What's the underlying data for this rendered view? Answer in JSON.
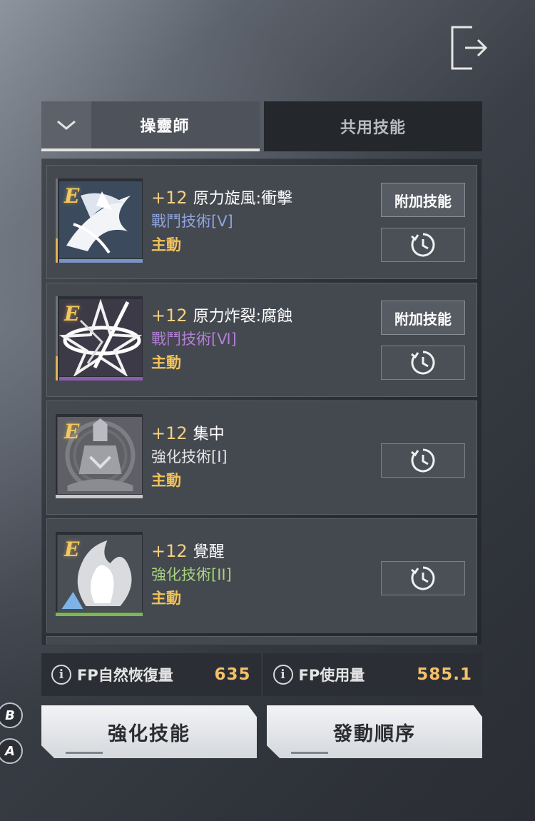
{
  "header": {
    "exit_icon": "exit-arrow-icon"
  },
  "tabs": {
    "toggle_icon": "chevron-down-icon",
    "active_label": "操靈師",
    "inactive_label": "共用技能"
  },
  "skills": [
    {
      "grade": "E",
      "level": "+12",
      "name": "原力旋風:衝擊",
      "category": "戰鬥技術[Ⅴ]",
      "category_color": "#8fa3de",
      "type": "主動",
      "extra_button": "附加技能",
      "cooldown_icon": "cooldown-clock-icon",
      "strip_color": "#7b93c4"
    },
    {
      "grade": "E",
      "level": "+12",
      "name": "原力炸裂:腐蝕",
      "category": "戰鬥技術[Ⅵ]",
      "category_color": "#b37fd6",
      "type": "主動",
      "extra_button": "附加技能",
      "cooldown_icon": "cooldown-clock-icon",
      "strip_color": "#8d5bb0"
    },
    {
      "grade": "E",
      "level": "+12",
      "name": "集中",
      "category": "強化技術[I]",
      "category_color": "#e6e6e6",
      "type": "主動",
      "cooldown_icon": "cooldown-clock-icon",
      "strip_color": "#c9c9c9"
    },
    {
      "grade": "E",
      "level": "+12",
      "name": "覺醒",
      "category": "強化技術[II]",
      "category_color": "#a7d47c",
      "type": "主動",
      "cooldown_icon": "cooldown-clock-icon",
      "strip_color": "#7fb65a"
    }
  ],
  "stats": {
    "info_icon": "i",
    "fp_recovery_label": "FP自然恢復量",
    "fp_recovery_value": "635",
    "fp_usage_label": "FP使用量",
    "fp_usage_value": "585.1"
  },
  "actions": {
    "enhance_label": "強化技能",
    "order_label": "發動順序"
  },
  "key_hints": {
    "b": "B",
    "a": "A"
  }
}
